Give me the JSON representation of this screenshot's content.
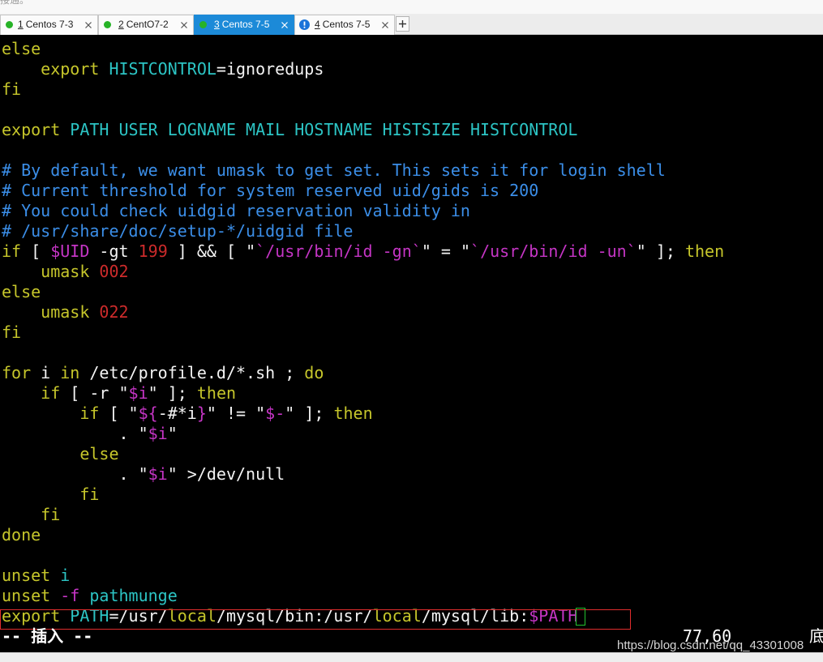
{
  "app": {
    "top_message": "接通。"
  },
  "colors": {
    "tab_text": "#1e1e1e",
    "tab_active_bg": "#1c8ad8",
    "tab_active_text": "#ffffff",
    "connected": "#27b327",
    "alert": "#1a73d9",
    "terminal_bg": "#000000",
    "terminal_text": "#f4f4f4",
    "status_text": "#ffffff",
    "highlight_box": "#e02d2d",
    "cursor": "#22c32e",
    "watermark": "#d6d6d6"
  },
  "icons": {
    "close": "close-icon",
    "new_tab": "plus-icon"
  },
  "tabs": [
    {
      "key": "1",
      "title": "Centos 7-3",
      "status_icon": "connected-dot-icon",
      "active": false
    },
    {
      "key": "2",
      "title": "CentO7-2",
      "status_icon": "connected-dot-icon",
      "active": false
    },
    {
      "key": "3",
      "title": "Centos 7-5",
      "status_icon": "connected-dot-icon",
      "active": true
    },
    {
      "key": "4",
      "title": "Centos 7-5",
      "status_icon": "alert-icon",
      "active": false
    }
  ],
  "terminal": {
    "lines": [
      [
        [
          "else",
          "#c6c62b"
        ]
      ],
      [
        [
          "    export ",
          "#c6c62b"
        ],
        [
          "HISTCONTROL",
          "#2cc4c4"
        ],
        [
          "=ignoredups",
          "#f4f4f4"
        ]
      ],
      [
        [
          "fi",
          "#c6c62b"
        ]
      ],
      [],
      [
        [
          "export",
          "#c6c62b"
        ],
        [
          " PATH USER LOGNAME MAIL HOSTNAME HISTSIZE HISTCONTROL",
          "#2cc4c4"
        ]
      ],
      [],
      [
        [
          "# By default, we want umask to get set. This sets it for login shell",
          "#3b8ee8"
        ]
      ],
      [
        [
          "# Current threshold for system reserved uid/gids is 200",
          "#3b8ee8"
        ]
      ],
      [
        [
          "# You could check uidgid reservation validity in",
          "#3b8ee8"
        ]
      ],
      [
        [
          "# /usr/share/doc/setup-*/uidgid file",
          "#3b8ee8"
        ]
      ],
      [
        [
          "if",
          "#c6c62b"
        ],
        [
          " [ ",
          "#f4f4f4"
        ],
        [
          "$UID",
          "#c535c5"
        ],
        [
          " -gt ",
          "#f4f4f4"
        ],
        [
          "199",
          "#cd2b2b"
        ],
        [
          " ] && [ \"",
          "#f4f4f4"
        ],
        [
          "`/usr/bin/id -gn`",
          "#c535c5"
        ],
        [
          "\" = \"",
          "#f4f4f4"
        ],
        [
          "`/usr/bin/id -un`",
          "#c535c5"
        ],
        [
          "\" ]; ",
          "#f4f4f4"
        ],
        [
          "then",
          "#c6c62b"
        ]
      ],
      [
        [
          "    umask ",
          "#c6c62b"
        ],
        [
          "002",
          "#cd2b2b"
        ]
      ],
      [
        [
          "else",
          "#c6c62b"
        ]
      ],
      [
        [
          "    umask ",
          "#c6c62b"
        ],
        [
          "022",
          "#cd2b2b"
        ]
      ],
      [
        [
          "fi",
          "#c6c62b"
        ]
      ],
      [],
      [
        [
          "for",
          "#c6c62b"
        ],
        [
          " i ",
          "#f4f4f4"
        ],
        [
          "in",
          "#c6c62b"
        ],
        [
          " /etc/profile.d/*.sh ; ",
          "#f4f4f4"
        ],
        [
          "do",
          "#c6c62b"
        ]
      ],
      [
        [
          "    if",
          "#c6c62b"
        ],
        [
          " [ -r \"",
          "#f4f4f4"
        ],
        [
          "$i",
          "#c535c5"
        ],
        [
          "\" ]; ",
          "#f4f4f4"
        ],
        [
          "then",
          "#c6c62b"
        ]
      ],
      [
        [
          "        if",
          "#c6c62b"
        ],
        [
          " [ \"",
          "#f4f4f4"
        ],
        [
          "${",
          "#c535c5"
        ],
        [
          "-#*i",
          "#f4f4f4"
        ],
        [
          "}",
          "#c535c5"
        ],
        [
          "\" != \"",
          "#f4f4f4"
        ],
        [
          "$-",
          "#c535c5"
        ],
        [
          "\" ]; ",
          "#f4f4f4"
        ],
        [
          "then",
          "#c6c62b"
        ]
      ],
      [
        [
          "            . \"",
          "#f4f4f4"
        ],
        [
          "$i",
          "#c535c5"
        ],
        [
          "\"",
          "#f4f4f4"
        ]
      ],
      [
        [
          "        else",
          "#c6c62b"
        ]
      ],
      [
        [
          "            . \"",
          "#f4f4f4"
        ],
        [
          "$i",
          "#c535c5"
        ],
        [
          "\" >/dev/null",
          "#f4f4f4"
        ]
      ],
      [
        [
          "        fi",
          "#c6c62b"
        ]
      ],
      [
        [
          "    fi",
          "#c6c62b"
        ]
      ],
      [
        [
          "done",
          "#c6c62b"
        ]
      ],
      [],
      [
        [
          "unset ",
          "#c6c62b"
        ],
        [
          "i",
          "#2cc4c4"
        ]
      ],
      [
        [
          "unset ",
          "#c6c62b"
        ],
        [
          "-f ",
          "#c535c5"
        ],
        [
          "pathmunge",
          "#2cc4c4"
        ]
      ],
      [
        [
          "export ",
          "#c6c62b"
        ],
        [
          "PATH",
          "#2cc4c4"
        ],
        [
          "=/usr/",
          "#f4f4f4"
        ],
        [
          "local",
          "#c6c62b"
        ],
        [
          "/mysql/bin:/usr/",
          "#f4f4f4"
        ],
        [
          "local",
          "#c6c62b"
        ],
        [
          "/mysql/lib:",
          "#f4f4f4"
        ],
        [
          "$PATH",
          "#c535c5"
        ]
      ]
    ]
  },
  "vim_status": {
    "mode": "-- 插入 --",
    "position": "77,60",
    "scroll": "底"
  },
  "watermark": "https://blog.csdn.net/qq_43301008"
}
